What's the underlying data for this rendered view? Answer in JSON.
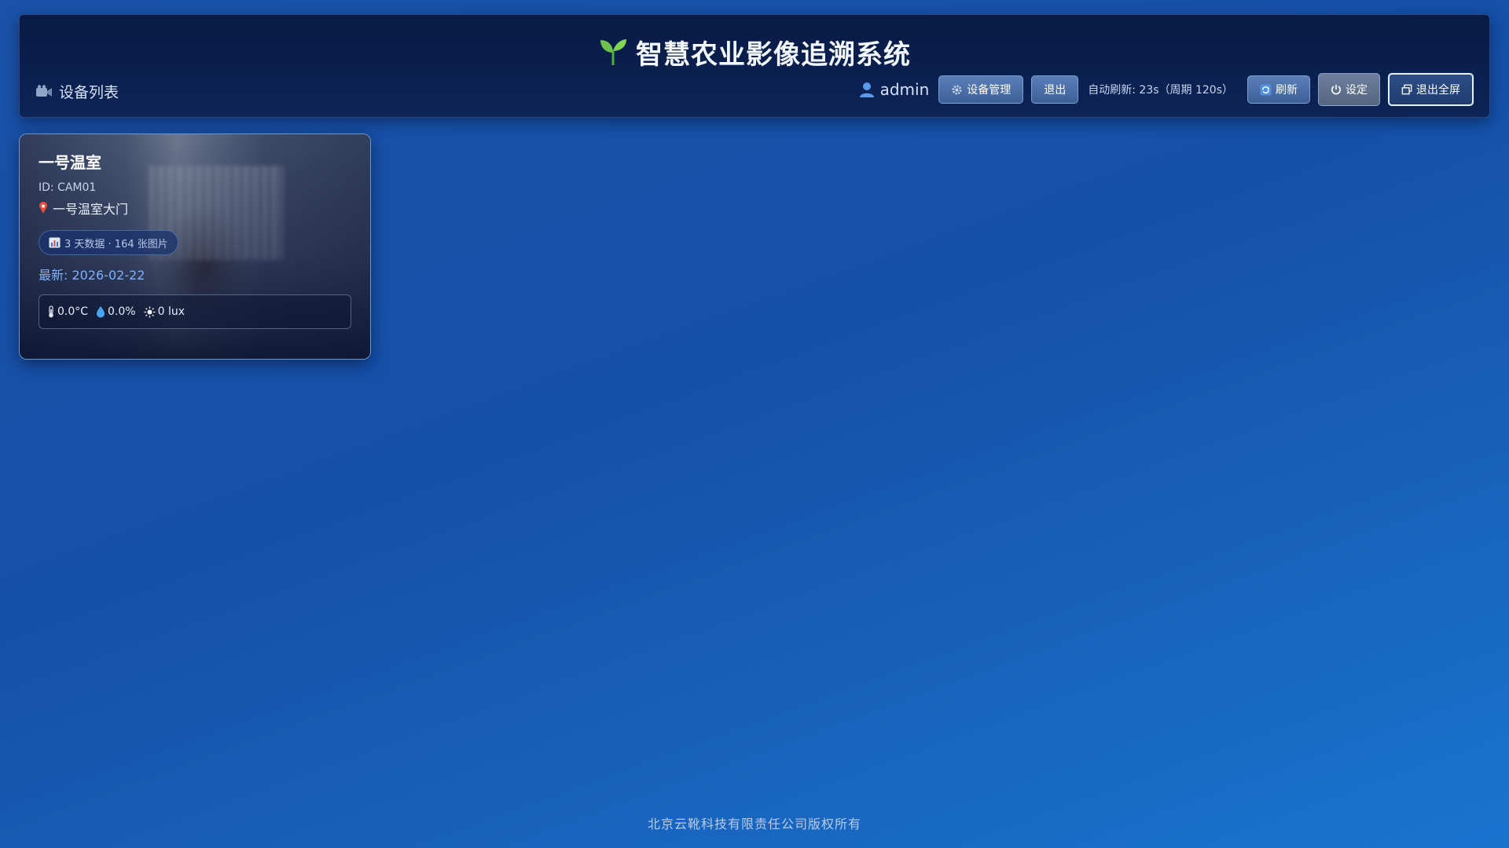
{
  "header": {
    "title": "智慧农业影像追溯系统",
    "device_list_label": "设备列表",
    "user": "admin",
    "buttons": {
      "device_manage": "设备管理",
      "logout": "退出",
      "refresh": "刷新",
      "settings": "设定",
      "exit_fullscreen": "退出全屏"
    },
    "auto_refresh_status": "自动刷新: 23s（周期 120s）"
  },
  "devices": [
    {
      "name": "一号温室",
      "id_text": "ID: CAM01",
      "location": "一号温室大门",
      "stats": "3 天数据 · 164 张图片",
      "latest": "最新: 2026-02-22",
      "temperature": "0.0°C",
      "humidity": "0.0%",
      "light": "0 lux"
    }
  ],
  "footer": {
    "copyright": "北京云靴科技有限责任公司版权所有"
  },
  "colors": {
    "background_start": "#1b52a8",
    "background_end": "#1a74cf",
    "header_bg": "#081a45",
    "accent_latest": "#7fb0ff",
    "button": "#4b6ea8"
  },
  "icons": {
    "title": "sprout-icon",
    "device_list": "video-camera-icon",
    "user": "user-icon",
    "device_manage": "gear-icon",
    "refresh": "refresh-icon",
    "settings": "power-icon",
    "exit_fullscreen": "restore-window-icon",
    "location": "pin-icon",
    "stats": "bar-chart-icon",
    "temperature": "thermometer-icon",
    "humidity": "water-drop-icon",
    "light": "sun-icon"
  }
}
